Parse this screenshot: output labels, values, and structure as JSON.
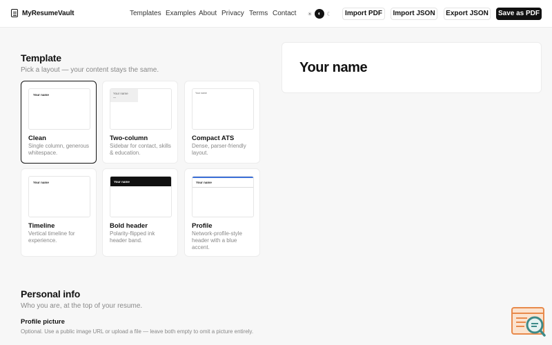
{
  "header": {
    "brand": "MyResumeVault",
    "nav": [
      "Templates",
      "Examples",
      "About",
      "Privacy",
      "Terms",
      "Contact"
    ],
    "theme_options": [
      {
        "icon": "sun-icon",
        "glyph": "☀",
        "active": false
      },
      {
        "icon": "contrast-icon",
        "glyph": "◐",
        "active": true
      },
      {
        "icon": "moon-icon",
        "glyph": "☾",
        "active": false
      }
    ],
    "buttons": {
      "import_pdf": "Import PDF",
      "import_json": "Import JSON",
      "export_json": "Export JSON",
      "save_pdf": "Save as PDF"
    }
  },
  "template_section": {
    "title": "Template",
    "subtitle": "Pick a layout — your content stays the same.",
    "selected": "Clean",
    "templates": [
      {
        "name": "Clean",
        "description": "Single column, generous whitespace.",
        "thumb_name": "Your name"
      },
      {
        "name": "Two-column",
        "description": "Sidebar for contact, skills & education.",
        "thumb_name": "Your name"
      },
      {
        "name": "Compact ATS",
        "description": "Dense, parser-friendly layout.",
        "thumb_name": "Your name"
      },
      {
        "name": "Timeline",
        "description": "Vertical timeline for experience.",
        "thumb_name": "Your name"
      },
      {
        "name": "Bold header",
        "description": "Polarity-flipped ink header band.",
        "thumb_name": "Your name"
      },
      {
        "name": "Profile",
        "description": "Network-profile-style header with a blue accent.",
        "thumb_name": "Your name"
      }
    ]
  },
  "preview": {
    "name": "Your name"
  },
  "personal_section": {
    "title": "Personal info",
    "subtitle": "Who you are, at the top of your resume.",
    "profile_picture": {
      "label": "Profile picture",
      "help": "Optional. Use a public image URL or upload a file — leave both empty to omit a picture entirely."
    }
  },
  "colors": {
    "ink": "#111111",
    "muted": "#888888",
    "accent_blue": "#3b6fd8",
    "widget_orange": "#e8894a",
    "widget_teal": "#3d8a88"
  }
}
